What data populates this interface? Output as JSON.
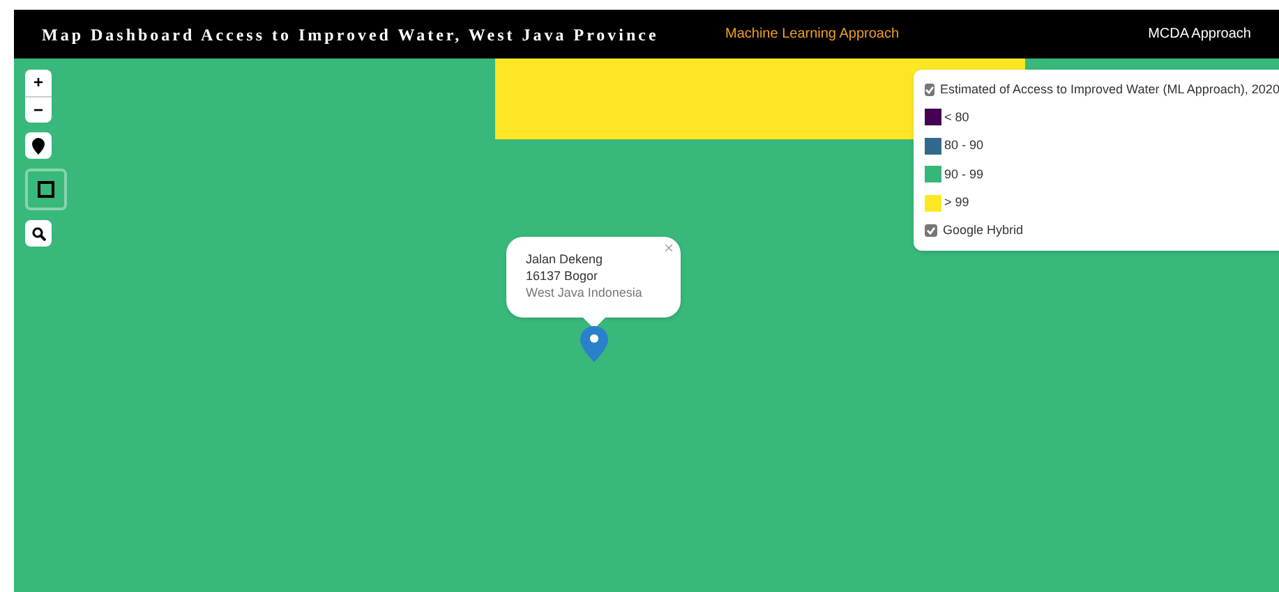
{
  "header": {
    "title": "Map Dashboard Access to Improved Water, West Java Province",
    "nav": [
      {
        "label": "Machine Learning Approach",
        "selected": true
      },
      {
        "label": "MCDA Approach",
        "selected": false
      }
    ]
  },
  "zoom_controls": [
    "+",
    "−"
  ],
  "popup": {
    "close": "×",
    "lines": [
      "Jalan Dekeng",
      "16137 Bogor",
      "West Java Indonesia"
    ]
  },
  "legend": {
    "layers": [
      {
        "label": "Estimated of Access to Improved Water (ML Approach), 2020",
        "checked": true
      },
      {
        "label": "Google Hybrid",
        "checked": true
      }
    ],
    "classes": [
      {
        "label": "< 80",
        "color": "#440154"
      },
      {
        "label": "80 - 90",
        "color": "#31688e"
      },
      {
        "label": "90 - 99",
        "color": "#35b779"
      },
      {
        "label": "> 99",
        "color": "#fde725"
      }
    ]
  }
}
